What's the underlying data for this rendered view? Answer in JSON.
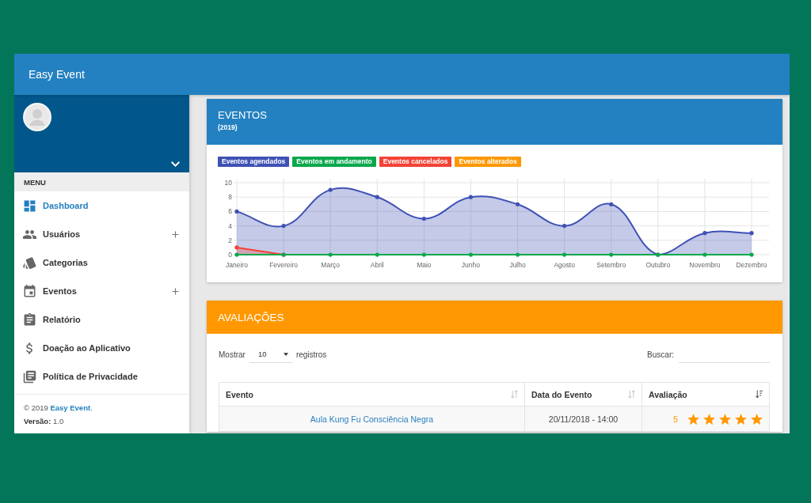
{
  "header": {
    "title": "Easy Event"
  },
  "sidebar": {
    "menu_label": "MENU",
    "items": [
      {
        "label": "Dashboard",
        "selected": true,
        "has_submenu": false
      },
      {
        "label": "Usuários",
        "selected": false,
        "has_submenu": true
      },
      {
        "label": "Categorias",
        "selected": false,
        "has_submenu": false
      },
      {
        "label": "Eventos",
        "selected": false,
        "has_submenu": true
      },
      {
        "label": "Relatório",
        "selected": false,
        "has_submenu": false
      },
      {
        "label": "Doação ao Aplicativo",
        "selected": false,
        "has_submenu": false
      },
      {
        "label": "Política de Privacidade",
        "selected": false,
        "has_submenu": false
      }
    ],
    "footer": {
      "copyright": "© 2019",
      "link": "Easy Event",
      "link_end": ".",
      "version": "**Versão:** 1.0"
    }
  },
  "eventos": {
    "title": "EVENTOS",
    "subtitle": "(2019)",
    "chart_data": {
      "type": "line",
      "grid": true,
      "categories": [
        "Janeiro",
        "Fevereiro",
        "Março",
        "Abril",
        "Maio",
        "Junho",
        "Julho",
        "Agosto",
        "Setembro",
        "Outubro",
        "Novembro",
        "Dezembro"
      ],
      "ylim": [
        0,
        10
      ],
      "yticks": [
        0,
        2,
        4,
        6,
        8,
        10
      ],
      "series": [
        {
          "name": "Eventos agendados",
          "color": "#3f51b5",
          "values": [
            6,
            4,
            9,
            8,
            5,
            8,
            7,
            4,
            7,
            0,
            3,
            3
          ]
        },
        {
          "name": "Eventos em andamento",
          "color": "#09a84c",
          "values": [
            0,
            0,
            0,
            0,
            0,
            0,
            0,
            0,
            0,
            0,
            0,
            0
          ]
        },
        {
          "name": "Eventos cancelados",
          "color": "#f44336",
          "values": [
            1,
            0,
            null,
            null,
            null,
            null,
            null,
            null,
            null,
            null,
            null,
            null
          ]
        }
      ]
    },
    "legend_without_data": [
      {
        "name": "Eventos alterados",
        "color": "#ff9800"
      }
    ]
  },
  "avaliacoes": {
    "title": "AVALIAÇÕES",
    "length_label": "Mostrar",
    "length_value": "10",
    "length_suffix": "registros",
    "search_label": "Buscar:",
    "table": {
      "columns": [
        {
          "label": "Evento",
          "sorted": false
        },
        {
          "label": "Data do Evento",
          "sorted": false
        },
        {
          "label": "Avaliação",
          "sorted": true
        }
      ],
      "rows": [
        {
          "evento": "Aula Kung Fu Consciência Negra",
          "data": "20/11/2018 - 14:00",
          "rating": "5",
          "stars": 5
        }
      ]
    }
  }
}
